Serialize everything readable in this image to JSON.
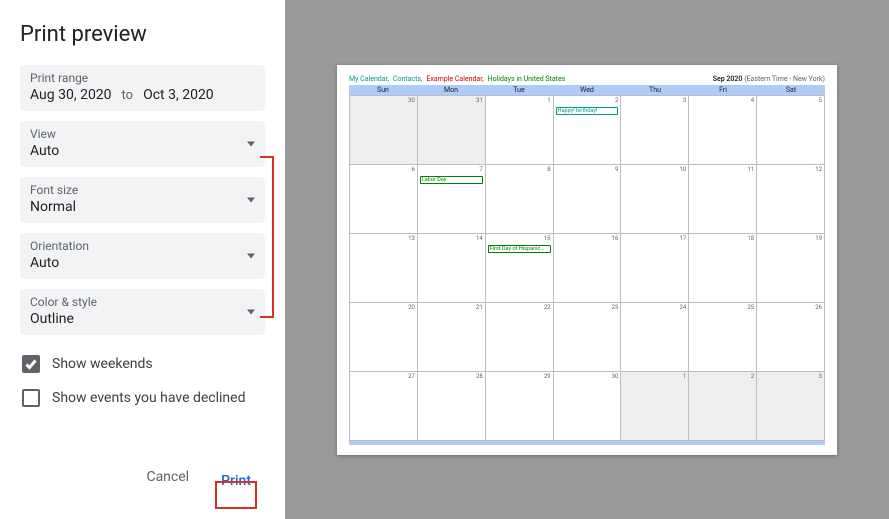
{
  "title": "Print preview",
  "printRange": {
    "label": "Print range",
    "start": "Aug 30, 2020",
    "to": "to",
    "end": "Oct 3, 2020"
  },
  "view": {
    "label": "View",
    "value": "Auto"
  },
  "fontSize": {
    "label": "Font size",
    "value": "Normal"
  },
  "orientation": {
    "label": "Orientation",
    "value": "Auto"
  },
  "colorStyle": {
    "label": "Color & style",
    "value": "Outline"
  },
  "showWeekends": {
    "label": "Show weekends",
    "checked": true
  },
  "showDeclined": {
    "label": "Show events you have declined",
    "checked": false
  },
  "buttons": {
    "cancel": "Cancel",
    "print": "Print"
  },
  "preview": {
    "calendars": [
      {
        "name": "My Calendar,",
        "cls": "cal-teal"
      },
      {
        "name": "Contacts,",
        "cls": "cal-teal"
      },
      {
        "name": "Example Calendar,",
        "cls": "cal-red"
      },
      {
        "name": "Holidays in United States",
        "cls": "cal-green"
      }
    ],
    "monthLabel": "Sep 2020",
    "tzLabel": "(Eastern Time - New York)",
    "weekdays": [
      "Sun",
      "Mon",
      "Tue",
      "Wed",
      "Thu",
      "Fri",
      "Sat"
    ],
    "weeks": [
      [
        {
          "d": "30",
          "out": true
        },
        {
          "d": "31",
          "out": true
        },
        {
          "d": "1"
        },
        {
          "d": "2",
          "events": [
            {
              "text": "Happy! birthday!",
              "cls": "ev-teal"
            }
          ]
        },
        {
          "d": "3"
        },
        {
          "d": "4"
        },
        {
          "d": "5"
        }
      ],
      [
        {
          "d": "6"
        },
        {
          "d": "7",
          "events": [
            {
              "text": "Labor Day",
              "cls": "ev-green"
            }
          ]
        },
        {
          "d": "8"
        },
        {
          "d": "9"
        },
        {
          "d": "10"
        },
        {
          "d": "11"
        },
        {
          "d": "12"
        }
      ],
      [
        {
          "d": "13"
        },
        {
          "d": "14"
        },
        {
          "d": "15",
          "events": [
            {
              "text": "First Day of Hispanic…",
              "cls": "ev-green"
            }
          ]
        },
        {
          "d": "16"
        },
        {
          "d": "17"
        },
        {
          "d": "18"
        },
        {
          "d": "19"
        }
      ],
      [
        {
          "d": "20"
        },
        {
          "d": "21"
        },
        {
          "d": "22"
        },
        {
          "d": "23"
        },
        {
          "d": "24"
        },
        {
          "d": "25"
        },
        {
          "d": "26"
        }
      ],
      [
        {
          "d": "27"
        },
        {
          "d": "28"
        },
        {
          "d": "29"
        },
        {
          "d": "30"
        },
        {
          "d": "1",
          "out": true
        },
        {
          "d": "2",
          "out": true
        },
        {
          "d": "3",
          "out": true
        }
      ]
    ]
  }
}
